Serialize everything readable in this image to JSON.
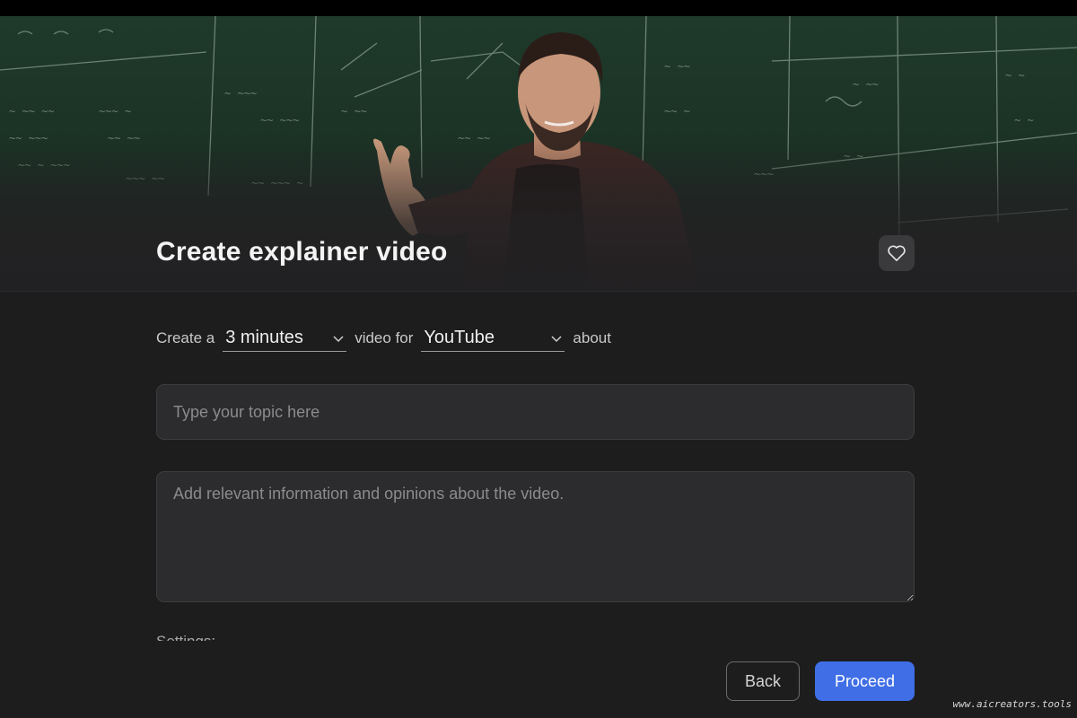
{
  "header": {
    "title": "Create explainer video",
    "favorite_icon": "heart-icon"
  },
  "config": {
    "prefix": "Create a",
    "duration_selected": "3 minutes",
    "middle": "video for",
    "platform_selected": "YouTube",
    "suffix": "about"
  },
  "topic_input": {
    "placeholder": "Type your topic here",
    "value": ""
  },
  "info_textarea": {
    "placeholder": "Add relevant information and opinions about the video.",
    "value": ""
  },
  "settings": {
    "label": "Settings:"
  },
  "footer": {
    "back_label": "Back",
    "proceed_label": "Proceed"
  },
  "watermark": "www.aicreators.tools",
  "colors": {
    "background": "#1d1d1d",
    "input_bg": "#2c2c2e",
    "accent": "#3f6ee6",
    "chalkboard": "#1f3a2a"
  }
}
